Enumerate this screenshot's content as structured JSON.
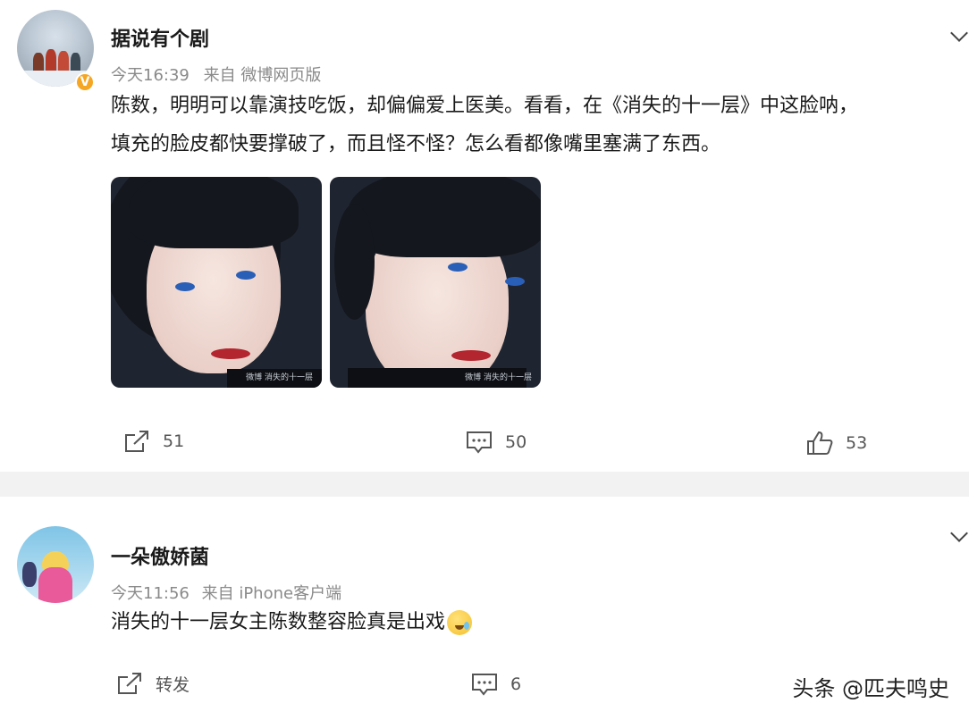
{
  "post1": {
    "username": "据说有个剧",
    "verified_badge": "V",
    "time": "今天16:39",
    "source": "来自 微博网页版",
    "content_lines": [
      "陈数，明明可以靠演技吃饭，却偏偏爱上医美。看看，在《消失的十一层》中这脸呐，",
      "填充的脸皮都快要撑破了，而且怪不怪？怎么看都像嘴里塞满了东西。"
    ],
    "images": [
      {
        "name": "post-image-1",
        "watermark": "微博 消失的十一层"
      },
      {
        "name": "post-image-2",
        "watermark": "微博 消失的十一层"
      }
    ],
    "actions": {
      "repost_count": "51",
      "comment_count": "50",
      "like_count": "53"
    }
  },
  "post2": {
    "username": "一朵傲娇菌",
    "time": "今天11:56",
    "source": "来自 iPhone客户端",
    "content": "消失的十一层女主陈数整容脸真是出戏",
    "actions": {
      "repost_label": "转发",
      "comment_count": "6"
    }
  },
  "watermark": "头条 @匹夫鸣史",
  "icons": [
    "repost-icon",
    "comment-icon",
    "like-icon",
    "chevron-down-icon"
  ]
}
